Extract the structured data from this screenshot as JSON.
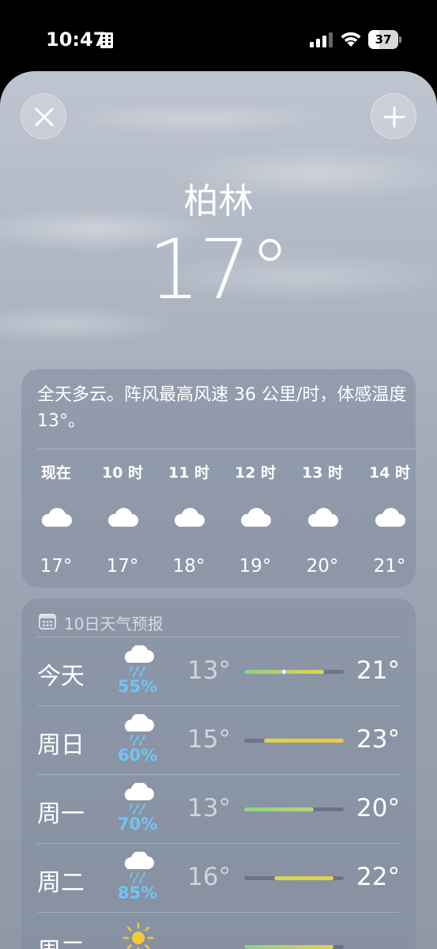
{
  "status_bar": {
    "time": "10:47",
    "battery_level": "37",
    "icons": [
      "building-icon",
      "signal-icon",
      "wifi-icon",
      "battery-icon"
    ]
  },
  "sheet": {
    "buttons": {
      "close": "close-icon",
      "add": "plus-icon"
    },
    "city": "柏林",
    "current_temp": "17°"
  },
  "hourly": {
    "summary": "全天多云。阵风最高风速 36 公里/时，体感温度 13°。",
    "hours": [
      {
        "label": "现在",
        "icon": "cloud-icon",
        "temp": "17°"
      },
      {
        "label": "10 时",
        "icon": "cloud-icon",
        "temp": "17°"
      },
      {
        "label": "11 时",
        "icon": "cloud-icon",
        "temp": "18°"
      },
      {
        "label": "12 时",
        "icon": "cloud-icon",
        "temp": "19°"
      },
      {
        "label": "13 时",
        "icon": "cloud-icon",
        "temp": "20°"
      },
      {
        "label": "14 时",
        "icon": "cloud-icon",
        "temp": "21°"
      }
    ]
  },
  "daily": {
    "header": "10日天气预报",
    "header_icon": "calendar-icon",
    "range_min": 13,
    "range_max": 23,
    "days": [
      {
        "name": "今天",
        "icon": "rain-cloud-icon",
        "precip": "55%",
        "low": "13°",
        "high": "21°",
        "low_value": 13,
        "high_value": 21,
        "current_value": 17,
        "color_start": "#8fcf8a",
        "color_end": "#e3d14a"
      },
      {
        "name": "周日",
        "icon": "rain-cloud-icon",
        "precip": "60%",
        "low": "15°",
        "high": "23°",
        "low_value": 15,
        "high_value": 23,
        "color_start": "#d9d34f",
        "color_end": "#eccb3d"
      },
      {
        "name": "周一",
        "icon": "rain-cloud-icon",
        "precip": "70%",
        "low": "13°",
        "high": "20°",
        "low_value": 13,
        "high_value": 20,
        "color_start": "#8fcf8a",
        "color_end": "#b9d673"
      },
      {
        "name": "周二",
        "icon": "rain-cloud-icon",
        "precip": "85%",
        "low": "16°",
        "high": "22°",
        "low_value": 16,
        "high_value": 22,
        "color_start": "#d4d35a",
        "color_end": "#e8cf45"
      },
      {
        "name": "周三",
        "icon": "sun-icon",
        "precip": "",
        "low": "",
        "high": "",
        "low_value": 13,
        "high_value": 22,
        "color_start": "#8fcf8a",
        "color_end": "#e3d14a"
      }
    ]
  },
  "colors": {
    "precip": "#6ec6f5",
    "sky_top": "#bfc5d0",
    "sky_bottom": "#8e98a6"
  }
}
